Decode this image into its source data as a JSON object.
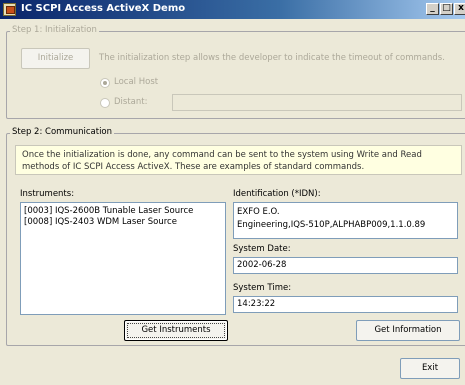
{
  "window": {
    "title": "IC SCPI Access ActiveX Demo",
    "minimize_glyph": "_",
    "maximize_glyph": "□",
    "close_glyph": "x"
  },
  "step1": {
    "legend": "Step 1: Initialization",
    "initialize_label": "Initialize",
    "description": "The initialization step allows the developer to indicate the timeout of commands.",
    "local_host_label": "Local Host",
    "distant_label": "Distant:",
    "distant_value": ""
  },
  "step2": {
    "legend": "Step 2: Communication",
    "description": "Once the initialization is done, any command can be sent to the system using Write and Read methods of IC SCPI Access ActiveX. These are examples of standard commands.",
    "instruments_label": "Instruments:",
    "instruments": [
      "[0003] IQS-2600B Tunable Laser Source",
      "[0008] IQS-2403 WDM Laser Source"
    ],
    "identification_label": "Identification (*IDN):",
    "identification_lines": [
      "EXFO E.O.",
      "Engineering,IQS-510P,ALPHABP009,1.1.0.89"
    ],
    "system_date_label": "System Date:",
    "system_date_value": "2002-06-28",
    "system_time_label": "System Time:",
    "system_time_value": "14:23:22",
    "get_instruments_label": "Get Instruments",
    "get_information_label": "Get Information"
  },
  "footer": {
    "exit_label": "Exit"
  }
}
